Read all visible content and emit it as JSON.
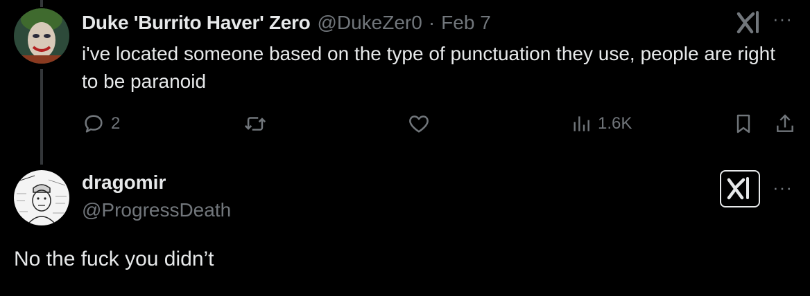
{
  "colors": {
    "background": "#000000",
    "primary_text": "#e7e9ea",
    "secondary_text": "#71767b",
    "thread_line": "#333639"
  },
  "tweet1": {
    "avatar_icon": "joker-face-avatar",
    "display_name": "Duke 'Burrito Haver' Zero",
    "handle": "@DukeZer0",
    "separator": "·",
    "date": "Feb 7",
    "text": "i've located someone based on the type of punctuation they use, people are right to be paranoid",
    "grok_icon": "grok-icon",
    "more_label": "···",
    "actions": {
      "reply_icon": "reply-icon",
      "reply_count": "2",
      "retweet_icon": "retweet-icon",
      "like_icon": "heart-icon",
      "views_icon": "views-icon",
      "views_count": "1.6K",
      "bookmark_icon": "bookmark-icon",
      "share_icon": "share-icon"
    }
  },
  "tweet2": {
    "avatar_icon": "wojak-sketch-avatar",
    "display_name": "dragomir",
    "handle": "@ProgressDeath",
    "text": "No the fuck you didn’t",
    "grok_icon": "grok-icon",
    "more_label": "···"
  }
}
